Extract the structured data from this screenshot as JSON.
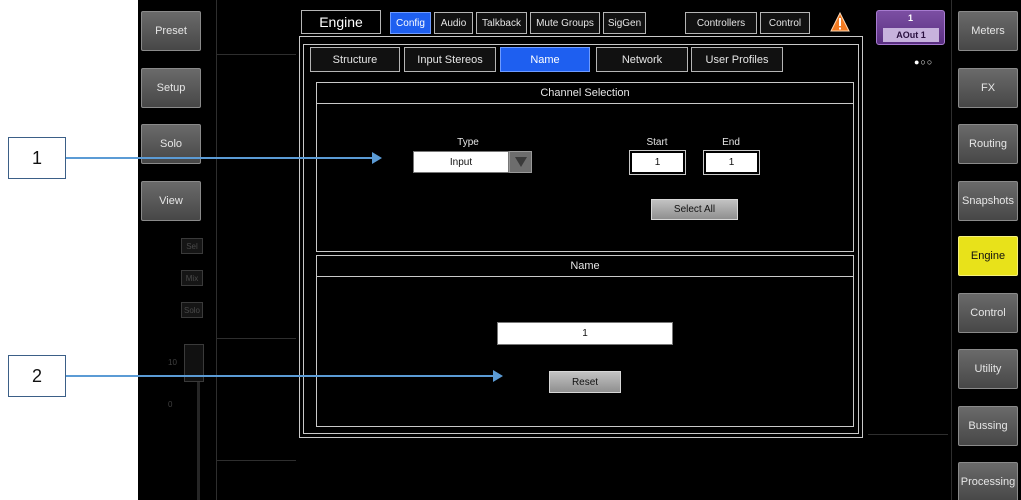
{
  "left_buttons": [
    "Preset",
    "Setup",
    "Solo",
    "View"
  ],
  "right_buttons": [
    "Meters",
    "FX",
    "Routing",
    "Snapshots",
    "Engine",
    "Control",
    "Utility",
    "Bussing",
    "Processing"
  ],
  "active_right_button": "Engine",
  "strip": {
    "sel_label": "Sel",
    "mix_label": "Mix",
    "solo_label": "Solo",
    "fader_scale": [
      "10",
      "0"
    ]
  },
  "header": {
    "title": "Engine",
    "tabs": [
      "Config",
      "Audio",
      "Talkback",
      "Mute Groups",
      "SigGen",
      "Controllers",
      "Control"
    ],
    "active_tab": "Config",
    "warning_icon": "warning-triangle-icon",
    "warning_color": "#f47a20"
  },
  "channel_badge": {
    "number": "1",
    "label": "AOut 1",
    "color": "#7c4fa3"
  },
  "page_indicator": "●○○",
  "sub_tabs": [
    "Structure",
    "Input Stereos",
    "Name",
    "Network",
    "User Profiles"
  ],
  "active_sub_tab": "Name",
  "channel_selection": {
    "title": "Channel Selection",
    "type_label": "Type",
    "type_value": "Input",
    "dropdown_icon": "triangle-down-icon",
    "start_label": "Start",
    "start_value": "1",
    "end_label": "End",
    "end_value": "1",
    "select_all_label": "Select All"
  },
  "name_section": {
    "title": "Name",
    "name_value": "1",
    "reset_label": "Reset"
  },
  "callouts": [
    "1",
    "2"
  ],
  "colors": {
    "accent_blue": "#1e5ff0",
    "active_yellow": "#e8e21a",
    "callout_arrow": "#5b9bd5"
  }
}
